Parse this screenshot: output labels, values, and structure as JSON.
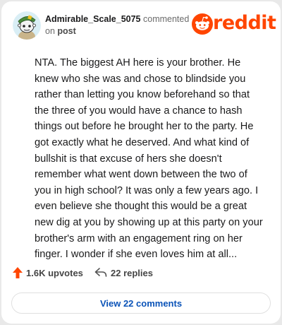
{
  "comment": {
    "username": "Admirable_Scale_5075",
    "action": "commented",
    "on_text": "on",
    "target": "post",
    "body": "NTA. The biggest AH here is your brother. He knew who she was and chose to blindside you rather than letting you know beforehand so that the three of you would have a chance to hash things out before he brought her to the party. He got exactly what he deserved. And what kind of bullshit is that excuse of hers she doesn't remember what went down between the two of you in high school? It was only a few years ago. I even believe she thought this would be a great new dig at you by showing up at this party on your brother's arm with an engagement ring on her finger. I wonder if she even loves him at all..."
  },
  "brand": {
    "wordmark": "reddit",
    "color": "#ff4500",
    "icon": "reddit-snoo-icon"
  },
  "actions": {
    "upvotes": "1.6K upvotes",
    "replies": "22 replies",
    "upvote_icon": "upvote-arrow-icon",
    "reply_icon": "reply-arrow-icon",
    "upvote_color": "#ff4500"
  },
  "view_button": {
    "label": "View 22 comments",
    "color": "#0a53b8"
  }
}
